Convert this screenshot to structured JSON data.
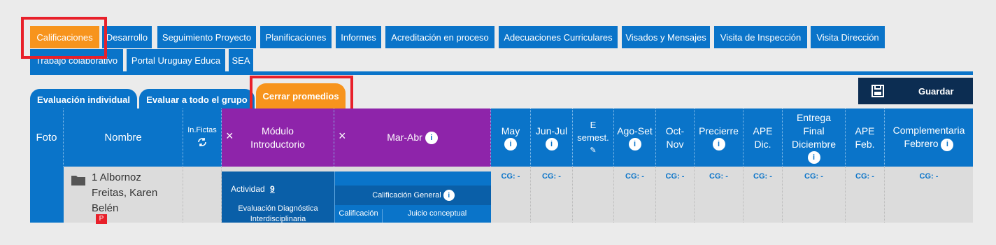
{
  "nav": {
    "tabs": [
      {
        "label": "Calificaciones"
      },
      {
        "label": "Desarrollo"
      },
      {
        "label": "Seguimiento Proyecto"
      },
      {
        "label": "Planificaciones"
      },
      {
        "label": "Informes"
      },
      {
        "label": "Acreditación en proceso"
      },
      {
        "label": "Adecuaciones Curriculares"
      },
      {
        "label": "Visados y Mensajes"
      },
      {
        "label": "Visita de Inspección"
      },
      {
        "label": "Visita Dirección"
      },
      {
        "label": "Trabajo colaborativo"
      },
      {
        "label": "Portal Uruguay Educa"
      },
      {
        "label": "SEA"
      }
    ],
    "active_color": "#f7941d",
    "color": "#0a74c9"
  },
  "subtabs": {
    "individual": "Evaluación individual",
    "grupo": "Evaluar a todo el grupo",
    "cerrar": "Cerrar promedios"
  },
  "save": {
    "label": "Guardar",
    "icon": "floppy-disk-icon"
  },
  "table": {
    "headers": {
      "foto": "Foto",
      "nombre": "Nombre",
      "infictas": "In.Fictas",
      "modulo": "Módulo Introductorio",
      "marabr": "Mar-Abr",
      "may": "May",
      "junjul": "Jun-Jul",
      "esemest_1": "E",
      "esemest_2": "semest.",
      "agoset": "Ago-Set",
      "octnov_1": "Oct-",
      "octnov_2": "Nov",
      "precierre": "Precierre",
      "apedic_1": "APE",
      "apedic_2": "Dic.",
      "entrega_1": "Entrega",
      "entrega_2": "Final",
      "entrega_3": "Diciembre",
      "apefeb_1": "APE",
      "apefeb_2": "Feb.",
      "complementaria_1": "Complementaria",
      "complementaria_2": "Febrero"
    },
    "info_glyph": "i",
    "close_glyph": "×",
    "cg": "CG: -",
    "student": {
      "line1": "1 Albornoz",
      "line2": "Freitas, Karen",
      "line3": "Belén",
      "badge": "P"
    },
    "detail": {
      "actividad": "Actividad",
      "actividad_num": "9",
      "evaluacion_1": "Evaluación Diagnóstica",
      "evaluacion_2": "Interdisciplinaria",
      "calif_general": "Calificación General",
      "calificacion": "Calificación",
      "juicio": "Juicio conceptual"
    }
  }
}
